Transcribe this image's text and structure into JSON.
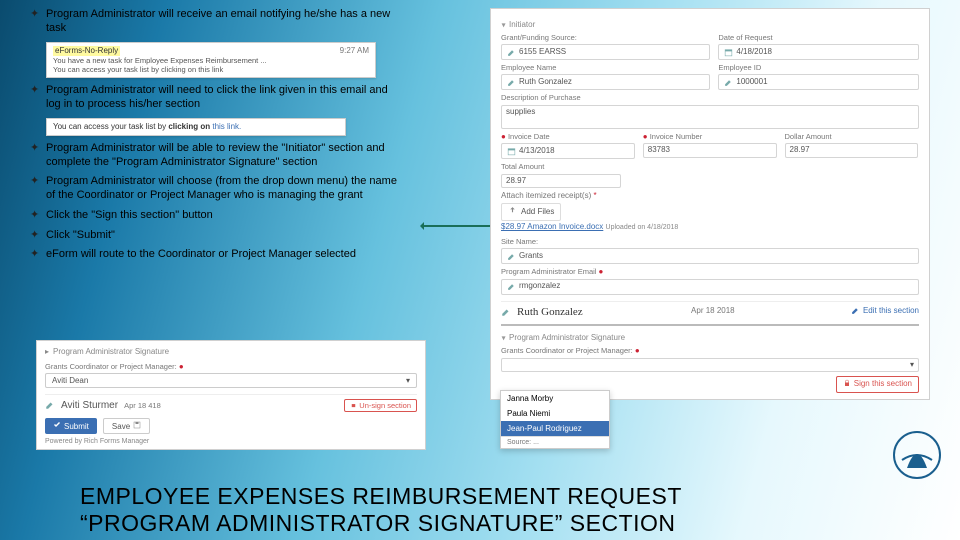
{
  "bullets": {
    "b1": "Program Administrator will receive an email notifying he/she has a new task",
    "b2": "Program Administrator will need to click the link given in this email and log in to process his/her section",
    "b3": "Program Administrator will be able to review the \"Initiator\" section and complete the \"Program Administrator Signature\" section",
    "b4": "Program Administrator will choose (from the drop down menu) the name of the Coordinator or Project Manager who is managing the grant",
    "b5": "Click the \"Sign this section\" button",
    "b6": "Click \"Submit\"",
    "b7": "eForm will route to the Coordinator or Project Manager selected"
  },
  "email_inset": {
    "from": "eForms-No-Reply",
    "time": "9:27 AM",
    "subj": "You have a new task for Employee Expenses Reimbursement ...",
    "body": "You can access your task list by clicking on this link"
  },
  "link_inset": "You can access your task list by clicking on this link.",
  "form": {
    "section_initiator": "Initiator",
    "grant_label": "Grant/Funding Source:",
    "grant_value": "6155 EARSS",
    "date_label": "Date of Request",
    "date_value": "4/18/2018",
    "emp_name_label": "Employee Name",
    "emp_name_value": "Ruth Gonzalez",
    "emp_id_label": "Employee ID",
    "emp_id_value": "1000001",
    "desc_label": "Description of Purchase",
    "desc_value": "supplies",
    "inv_date_label": "Invoice Date",
    "inv_date_value": "4/13/2018",
    "inv_num_label": "Invoice Number",
    "inv_num_value": "83783",
    "amount_label": "Dollar Amount",
    "amount_value": "28.97",
    "total_label": "Total Amount",
    "total_value": "28.97",
    "attach_label": "Attach itemized receipt(s)",
    "add_files": "Add Files",
    "attach_link": "$28.97 Amazon Invoice.docx",
    "attach_when": "Uploaded on 4/18/2018",
    "site_label": "Site Name:",
    "site_value": "Grants",
    "pa_email_label": "Program Administrator Email",
    "pa_email_value": "rmgonzalez",
    "sig_name": "Ruth Gonzalez",
    "sig_date": "Apr 18 2018",
    "edit": "Edit this section",
    "pa_sig_head": "Program Administrator Signature",
    "coord_label": "Grants Coordinator or Project Manager:",
    "sign_btn": "Sign this section"
  },
  "dropdown": {
    "opt1": "Janna Morby",
    "opt2": "Paula Niemi",
    "opt3": "Jean-Paul Rodriguez",
    "src": "Source: ..."
  },
  "blbox": {
    "head": "Program Administrator Signature",
    "coord_label": "Grants Coordinator or Project Manager:",
    "sel_value": "Aviti Dean",
    "sig_name": "Aviti Sturmer",
    "sig_date": "Apr 18 418",
    "unsign": "Un-sign section",
    "submit": "Submit",
    "save": "Save",
    "foot": "Powered by Rich Forms Manager"
  },
  "title": {
    "l1": "EMPLOYEE EXPENSES REIMBURSEMENT REQUEST",
    "l2": "“PROGRAM ADMINISTRATOR SIGNATURE” SECTION"
  },
  "icons": {
    "marker": "✦",
    "chev_down": "▾",
    "required": "*"
  },
  "colors": {
    "accent_blue": "#3b6fb3",
    "danger": "#d9534f",
    "arrow": "#1a6e58"
  }
}
